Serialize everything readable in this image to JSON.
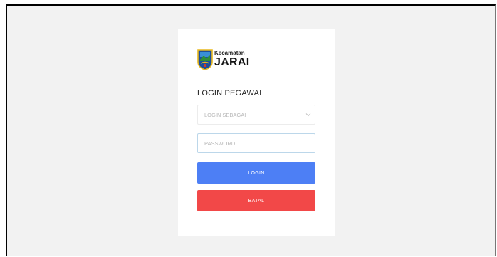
{
  "logo": {
    "subtitle": "Kecamatan",
    "name": "JARAI",
    "emblem_icon": "regency-shield-icon"
  },
  "form": {
    "heading": "LOGIN PEGAWAI",
    "role_select": {
      "selected": "LOGIN SEBAGAI",
      "icon": "chevron-down-icon"
    },
    "password": {
      "value": "",
      "placeholder": "PASSWORD"
    },
    "login_label": "LOGIN",
    "cancel_label": "BATAL"
  },
  "colors": {
    "background": "#f2f2f2",
    "card": "#ffffff",
    "login_button": "#4d7ff5",
    "cancel_button": "#f24848"
  }
}
